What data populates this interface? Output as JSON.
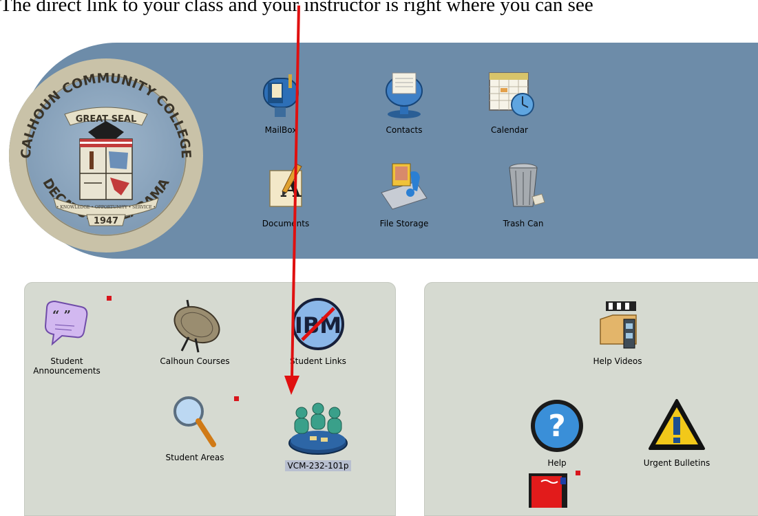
{
  "caption": "The direct link to your class and your instructor is right where you can see",
  "seal": {
    "top_text": "CALHOUN COMMUNITY COLLEGE",
    "inner_text": "GREAT SEAL",
    "motto": "• KNOWLEDGE • OPPORTUNITY • SERVICE •",
    "year": "1947",
    "bottom_text": "DECATUR • ALABAMA"
  },
  "toolbar": {
    "items": [
      {
        "label": "MailBox",
        "icon": "mailbox-icon"
      },
      {
        "label": "Contacts",
        "icon": "contacts-icon"
      },
      {
        "label": "Calendar",
        "icon": "calendar-icon"
      },
      {
        "label": "Documents",
        "icon": "documents-icon"
      },
      {
        "label": "File Storage",
        "icon": "file-storage-icon"
      },
      {
        "label": "Trash Can",
        "icon": "trash-can-icon"
      }
    ]
  },
  "left_panel": {
    "items": [
      {
        "label": "Student Announcements",
        "label_line1": "Student",
        "label_line2": "Announcements",
        "icon": "speech-bubble-icon",
        "flag": true
      },
      {
        "label": "Calhoun Courses",
        "icon": "satellite-dish-icon",
        "flag": false
      },
      {
        "label": "Student Links",
        "icon": "no-ibm-icon",
        "flag": false
      },
      {
        "label": "Student Areas",
        "icon": "magnifying-glass-icon",
        "flag": true
      },
      {
        "label": "VCM-232-101p",
        "icon": "class-group-icon",
        "flag": false,
        "selected": true
      }
    ]
  },
  "right_panel": {
    "items": [
      {
        "label": "Help Videos",
        "icon": "video-folder-icon"
      },
      {
        "label": "Help",
        "icon": "help-icon"
      },
      {
        "label": "Urgent Bulletins",
        "icon": "warning-icon"
      },
      {
        "label": "",
        "icon": "bulletin-board-icon",
        "flag": true
      }
    ]
  },
  "colors": {
    "header_band": "#6d8ca9",
    "panel_bg": "#d6dad1",
    "flag": "#d8151c",
    "arrow": "#e01010"
  }
}
